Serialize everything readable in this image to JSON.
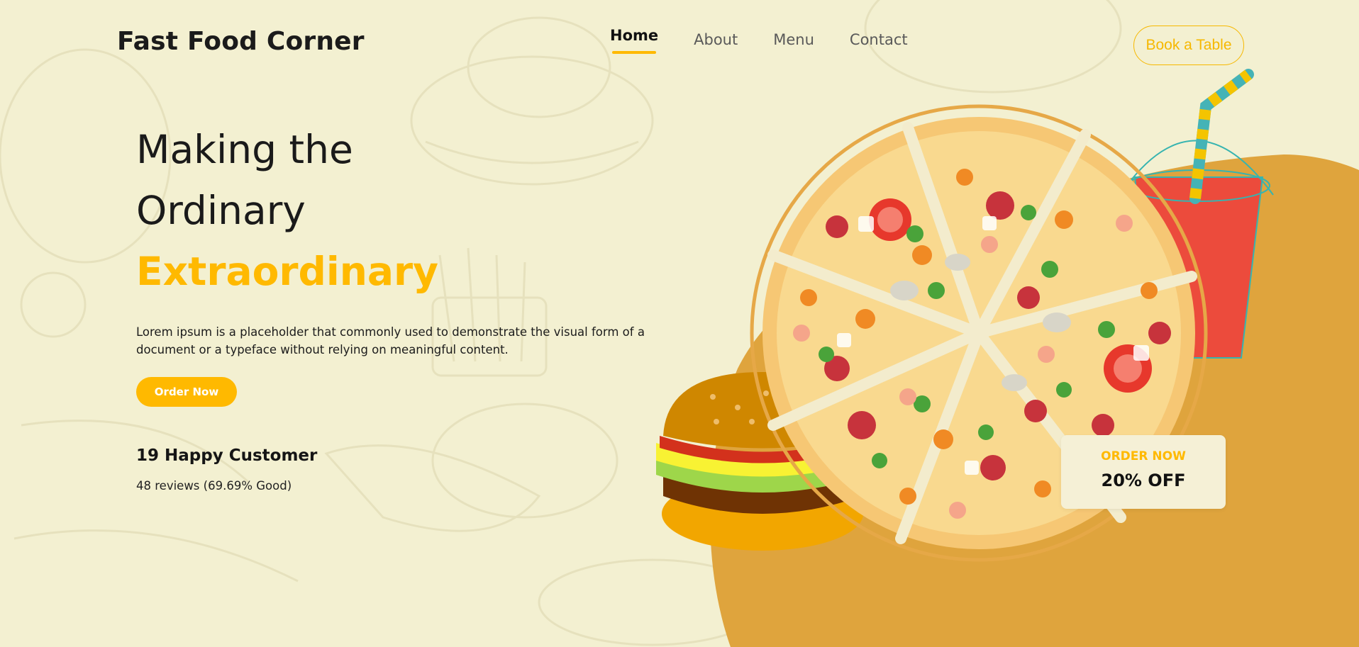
{
  "brand": {
    "name": "Fast Food Corner"
  },
  "nav": {
    "items": [
      {
        "label": "Home"
      },
      {
        "label": "About"
      },
      {
        "label": "Menu"
      },
      {
        "label": "Contact"
      }
    ],
    "active": "Home"
  },
  "header": {
    "book_label": "Book a Table"
  },
  "hero": {
    "title_line1": "Making the",
    "title_line2": "Ordinary",
    "title_accent": "Extraordinary",
    "description": "Lorem ipsum is a placeholder that commonly used to demonstrate the visual form of a document or a typeface without relying on meaningful content.",
    "order_label": "Order Now",
    "customers": "19 Happy Customer",
    "reviews": "48 reviews (69.69% Good)"
  },
  "promo": {
    "label": "ORDER NOW",
    "value": "20% OFF"
  },
  "colors": {
    "background": "#f3f0d1",
    "accent": "#ffb900",
    "blob": "#dfa43d"
  },
  "icons": {
    "hero_image": "pizza-burger-drink-illustration"
  }
}
